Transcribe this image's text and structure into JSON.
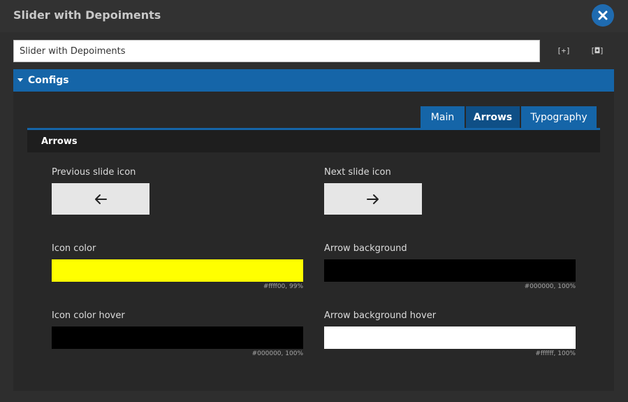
{
  "window": {
    "title": "Slider with Depoiments",
    "close_icon": "close-icon",
    "accent_color": "#1565a8"
  },
  "name_field": {
    "value": "Slider with Depoiments",
    "placeholder": ""
  },
  "toolbar": {
    "expand_label": "[+]",
    "inspect_label": "[◘]"
  },
  "section": {
    "label": "Configs",
    "expanded": true
  },
  "tabs": [
    {
      "label": "Main",
      "active": false
    },
    {
      "label": "Arrows",
      "active": true
    },
    {
      "label": "Typography",
      "active": false
    }
  ],
  "arrows": {
    "heading": "Arrows",
    "prev_icon": {
      "label": "Previous slide icon",
      "icon": "arrow-left-icon"
    },
    "next_icon": {
      "label": "Next slide icon",
      "icon": "arrow-right-icon"
    },
    "icon_color": {
      "label": "Icon color",
      "color": "#ffff00",
      "value": "#ffff00, 99%"
    },
    "arrow_bg": {
      "label": "Arrow background",
      "color": "#000000",
      "value": "#000000, 100%"
    },
    "icon_color_hover": {
      "label": "Icon color hover",
      "color": "#000000",
      "value": "#000000, 100%"
    },
    "arrow_bg_hover": {
      "label": "Arrow background hover",
      "color": "#ffffff",
      "value": "#ffffff, 100%"
    }
  }
}
